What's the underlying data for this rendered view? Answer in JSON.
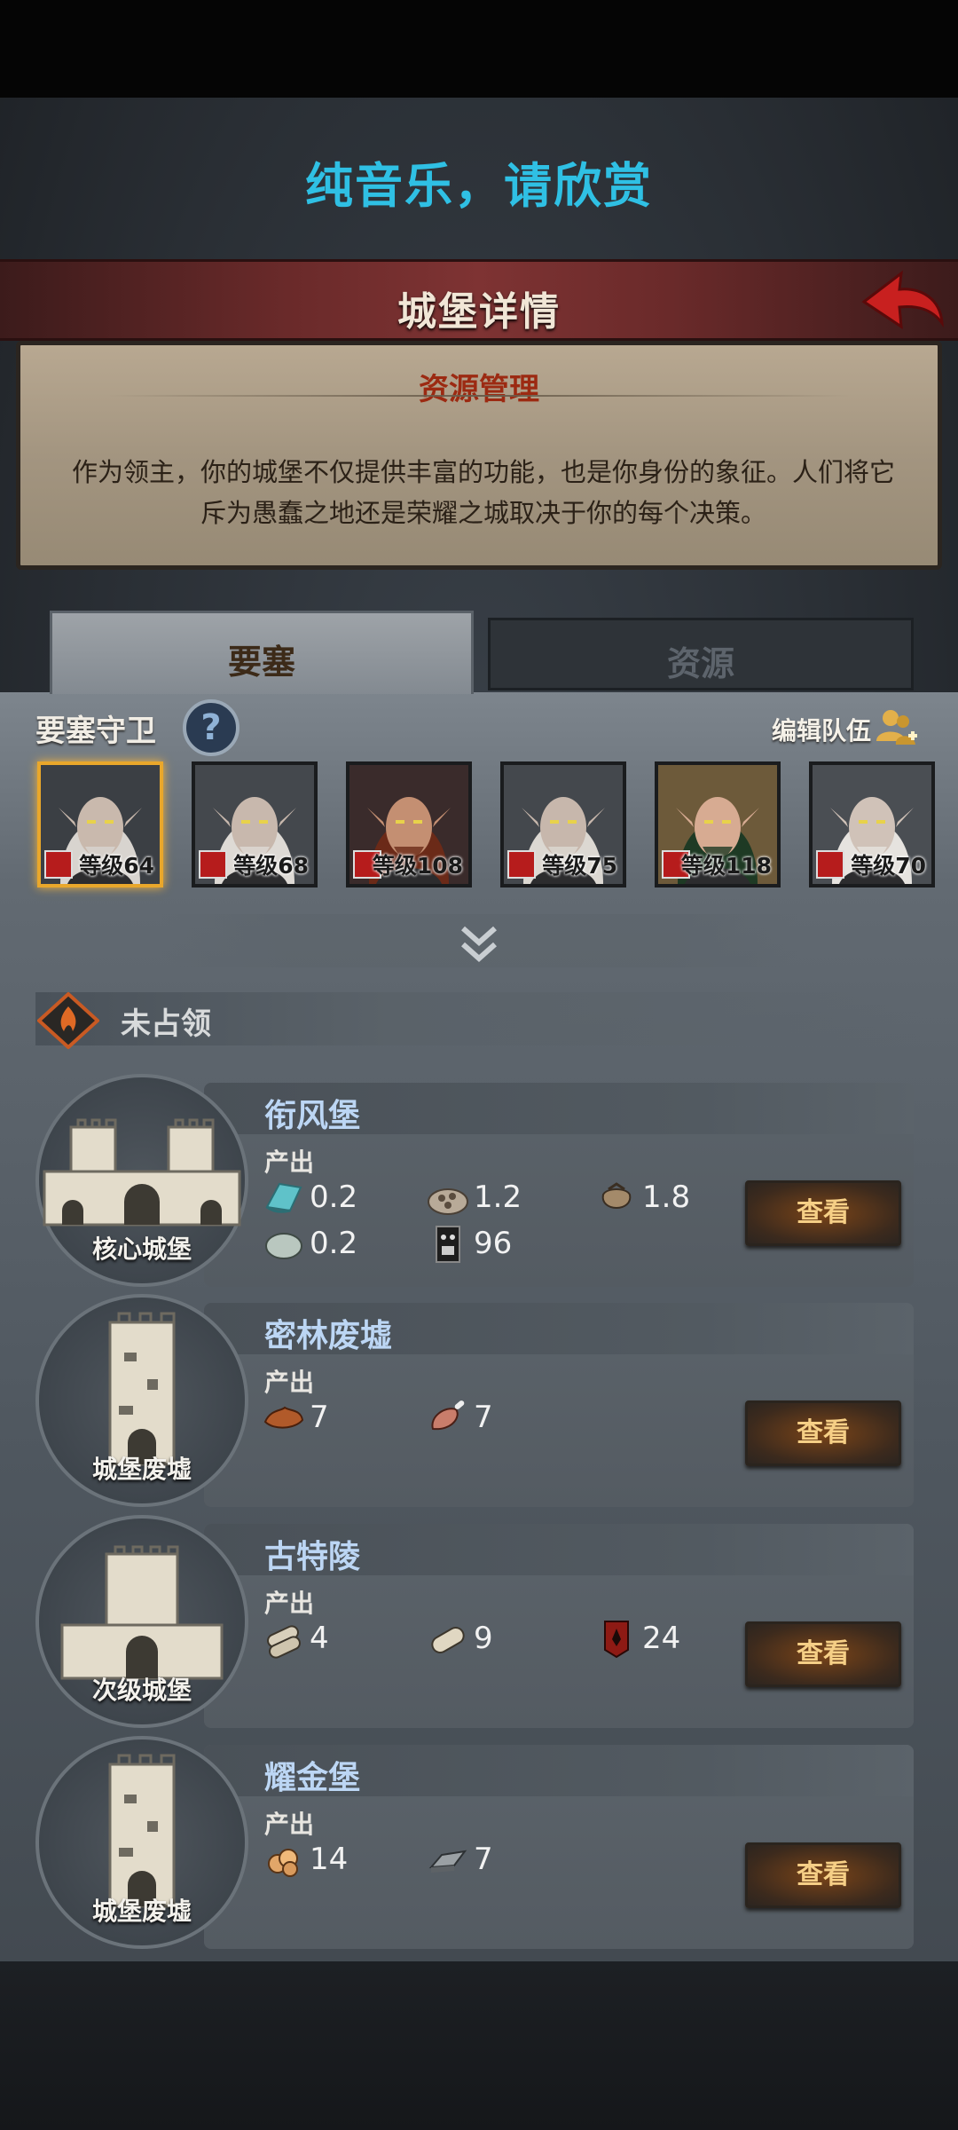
{
  "song_title": "纯音乐，请欣赏",
  "header": {
    "title": "城堡详情"
  },
  "info": {
    "title": "资源管理",
    "text": "作为领主，你的城堡不仅提供丰富的功能，也是你身份的象征。人们将它斥为愚蠢之地还是荣耀之城取决于你的每个决策。"
  },
  "tabs": [
    {
      "label": "要塞"
    },
    {
      "label": "资源"
    }
  ],
  "guards": {
    "label": "要塞守卫",
    "edit_label": "编辑队伍",
    "heroes": [
      {
        "level": "等级64",
        "selected": true
      },
      {
        "level": "等级68"
      },
      {
        "level": "等级108"
      },
      {
        "level": "等级75"
      },
      {
        "level": "等级118"
      },
      {
        "level": "等级70"
      }
    ]
  },
  "section": {
    "label": "未占领"
  },
  "output_label": "产出",
  "view_label": "查看",
  "castles": [
    {
      "name": "衔风堡",
      "type": "核心城堡",
      "resources": [
        {
          "icon": "cloth-icon",
          "value": "0.2"
        },
        {
          "icon": "ore-pile-icon",
          "value": "1.2"
        },
        {
          "icon": "sack-icon",
          "value": "1.8"
        },
        {
          "icon": "stone-icon",
          "value": "0.2"
        },
        {
          "icon": "soldier-icon",
          "value": "96"
        }
      ]
    },
    {
      "name": "密林废墟",
      "type": "城堡废墟",
      "resources": [
        {
          "icon": "leather-icon",
          "value": "7"
        },
        {
          "icon": "meat-icon",
          "value": "7"
        }
      ]
    },
    {
      "name": "古特陵",
      "type": "次级城堡",
      "resources": [
        {
          "icon": "scroll-icon",
          "value": "4"
        },
        {
          "icon": "parchment-icon",
          "value": "9"
        },
        {
          "icon": "banner-icon",
          "value": "24"
        }
      ]
    },
    {
      "name": "耀金堡",
      "type": "城堡废墟",
      "resources": [
        {
          "icon": "gold-ore-icon",
          "value": "14"
        },
        {
          "icon": "iron-ingot-icon",
          "value": "7"
        }
      ]
    }
  ]
}
